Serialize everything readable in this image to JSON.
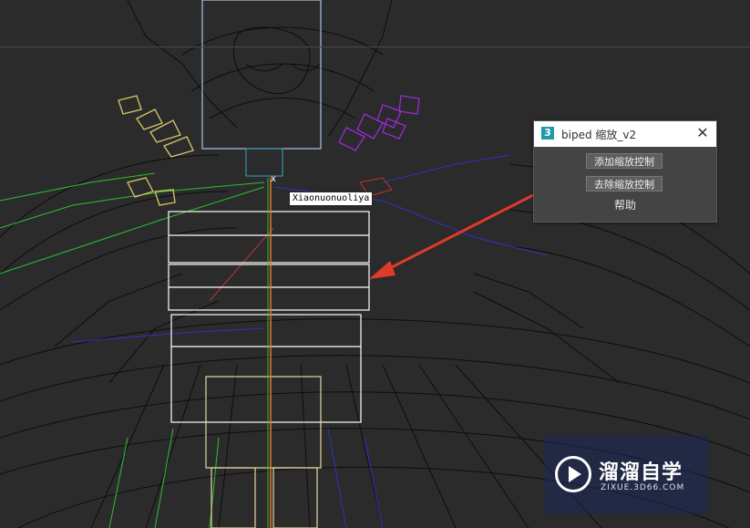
{
  "viewport": {
    "scene": "3ds Max wireframe viewport: character mesh with biped rig",
    "colors": {
      "background": "#2b2b2b",
      "mesh": "#0d0d0d",
      "left_hand": "#d8c86a",
      "right_hand": "#9a2ad8",
      "left_arm": "#2fbf2f",
      "right_arm": "#3030c8",
      "spine": "#ffffff",
      "arrow": "#e03a2a"
    }
  },
  "dialog": {
    "icon_label": "3",
    "title": "biped 缩放_v2",
    "add_button": "添加缩放控制",
    "remove_button": "去除缩放控制",
    "help_label": "帮助"
  },
  "object_tag": "Xiaonuonuoliya",
  "watermark": {
    "main": "溜溜自学",
    "sub": "ZIXUE.3D66.COM"
  }
}
